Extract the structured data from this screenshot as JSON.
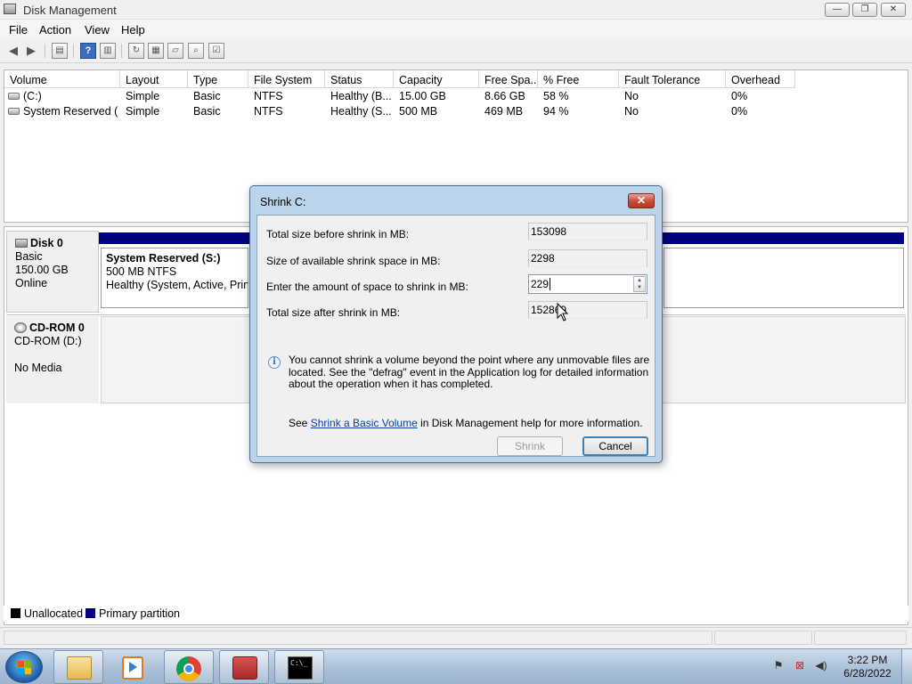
{
  "window": {
    "title": "Disk Management",
    "min_glyph": "—",
    "max_glyph": "❐",
    "close_glyph": "✕"
  },
  "menu": [
    "File",
    "Action",
    "View",
    "Help"
  ],
  "toolbar": {
    "icons": [
      "back-icon",
      "forward-icon",
      "properties-pane-icon",
      "help-icon",
      "show-hide-pane-icon",
      "refresh-icon",
      "rescan-disks-icon",
      "open-icon",
      "explore-icon",
      "properties-icon"
    ],
    "help_glyph": "?"
  },
  "volume_list": {
    "columns": [
      "Volume",
      "Layout",
      "Type",
      "File System",
      "Status",
      "Capacity",
      "Free Spa...",
      "% Free",
      "Fault Tolerance",
      "Overhead"
    ],
    "rows": [
      [
        "(C:)",
        "Simple",
        "Basic",
        "NTFS",
        "Healthy (B...",
        "15.00 GB",
        "8.66 GB",
        "58 %",
        "No",
        "0%"
      ],
      [
        "System Reserved (...",
        "Simple",
        "Basic",
        "NTFS",
        "Healthy (S...",
        "500 MB",
        "469 MB",
        "94 %",
        "No",
        "0%"
      ]
    ]
  },
  "disks": {
    "disk0": {
      "name": "Disk 0",
      "type": "Basic",
      "size": "150.00 GB",
      "state": "Online"
    },
    "partition": {
      "name": "System Reserved  (S:)",
      "size_fs": "500 MB NTFS",
      "status": "Healthy (System, Active, Prima"
    },
    "cdrom": {
      "name": "CD-ROM 0",
      "device": "CD-ROM (D:)",
      "media": "No Media"
    }
  },
  "legend": [
    {
      "label": "Unallocated",
      "color": "#000000"
    },
    {
      "label": "Primary partition",
      "color": "#000080"
    }
  ],
  "dialog": {
    "title": "Shrink C:",
    "close_glyph": "✕",
    "rows": [
      {
        "label": "Total size before shrink in MB:",
        "value": "153098"
      },
      {
        "label": "Size of available shrink space in MB:",
        "value": "2298"
      },
      {
        "label": "Enter the amount of space to shrink in MB:",
        "value": "229"
      },
      {
        "label": "Total size after shrink in MB:",
        "value": "152869"
      }
    ],
    "info_glyph": "i",
    "info": "You cannot shrink a volume beyond the point where any unmovable files are located. See the \"defrag\" event in the Application log for detailed information about the operation when it has completed.",
    "help_prefix": "See ",
    "help_link": "Shrink a Basic Volume",
    "help_suffix": " in Disk Management help for more information.",
    "shrink_label": "Shrink",
    "cancel_label": "Cancel",
    "spin_up": "▲",
    "spin_down": "▼"
  },
  "taskbar": {
    "apps": [
      "windows-explorer-icon",
      "media-player-icon",
      "chrome-icon",
      "toolbox-icon",
      "command-prompt-icon"
    ],
    "cmd_text": "C:\\_",
    "time": "3:22 PM",
    "date": "6/28/2022"
  },
  "colors": {
    "partition": "#000080",
    "dialog_frame": "#bcd3ec",
    "link": "#0044aa",
    "close_red": "#c84a32"
  }
}
